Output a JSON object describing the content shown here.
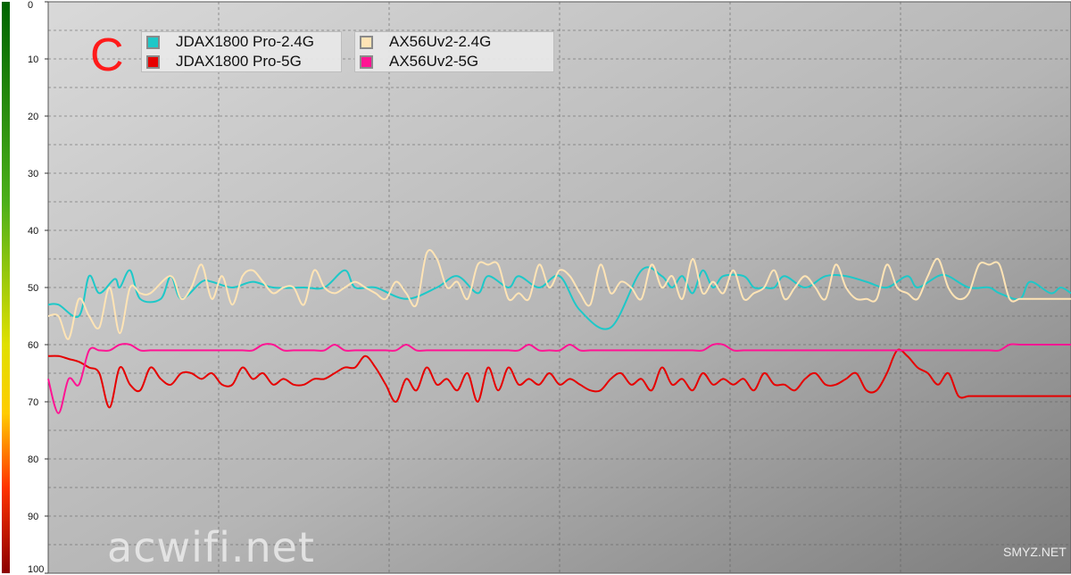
{
  "panel_letter": "C",
  "watermarks": {
    "main": "acwifi.net",
    "small": "SMYZ.NET"
  },
  "chart_data": {
    "type": "line",
    "title": "",
    "xlabel": "",
    "ylabel": "",
    "ylim": [
      100,
      0
    ],
    "yticks": [
      "0",
      "10",
      "20",
      "30",
      "40",
      "50",
      "60",
      "70",
      "80",
      "90",
      "100"
    ],
    "xlim": [
      0,
      100
    ],
    "grid": true,
    "legend_position": "top-left",
    "colors": {
      "background_top": "#d4d4d4",
      "background_bottom": "#808080"
    },
    "series": [
      {
        "name": "JDAX1800 Pro-2.4G",
        "color": "#1ec8c8",
        "x": [
          0,
          1,
          3,
          4,
          5,
          6.5,
          7,
          8,
          9,
          11,
          12,
          13,
          15,
          16,
          18,
          20,
          22,
          25,
          27,
          29,
          30,
          32,
          35,
          38,
          40,
          42,
          43,
          45,
          46,
          48,
          50,
          52,
          55,
          58,
          60,
          61,
          62,
          63,
          64,
          65,
          66,
          68,
          69,
          70,
          71,
          72,
          74,
          76,
          78,
          80,
          82,
          84,
          85,
          87,
          88,
          90,
          92,
          93,
          95,
          96,
          98,
          99,
          100
        ],
        "y": [
          53,
          53,
          55,
          48,
          51,
          48.5,
          50,
          47,
          52,
          52,
          48,
          52,
          49,
          49,
          50,
          49,
          50,
          50,
          50,
          47,
          50,
          50,
          52,
          50,
          48,
          51,
          48,
          50,
          48,
          50,
          48,
          54,
          57,
          47,
          48,
          50,
          48,
          51,
          47,
          50,
          48,
          48,
          50,
          50,
          50,
          48,
          50,
          48,
          48,
          49,
          50,
          48,
          50,
          48,
          48,
          50,
          50,
          51,
          52,
          49,
          51,
          50,
          51
        ],
        "note": ""
      },
      {
        "name": "AX56Uv2-2.4G",
        "color": "#ffe4b5",
        "x": [
          0,
          1,
          2,
          3,
          4,
          5,
          6,
          7,
          8,
          9,
          10,
          12,
          13,
          14,
          15,
          16,
          17,
          18,
          19,
          20,
          21,
          22,
          23,
          24,
          25,
          26,
          27,
          28,
          29,
          30,
          31,
          32,
          33,
          34,
          35,
          36,
          37,
          38,
          39,
          40,
          41,
          42,
          43,
          44,
          45,
          46,
          47,
          48,
          49,
          50,
          51,
          52,
          53,
          54,
          55,
          56,
          57,
          58,
          59,
          60,
          61,
          62,
          63,
          64,
          65,
          66,
          67,
          68,
          69,
          70,
          71,
          72,
          73,
          74,
          75,
          76,
          77,
          78,
          79,
          80,
          81,
          82,
          83,
          84,
          85,
          86,
          87,
          88,
          89,
          90,
          91,
          92,
          93,
          94,
          95,
          96,
          97,
          98,
          99,
          100
        ],
        "y": [
          55,
          55,
          59,
          52,
          55,
          57,
          50,
          58,
          50,
          51,
          51,
          48,
          52,
          50,
          46,
          52,
          48,
          53,
          48,
          47,
          49,
          51,
          50,
          50,
          53,
          47,
          50,
          51,
          50,
          49,
          50,
          51,
          52,
          49,
          51,
          53,
          44,
          45,
          50,
          49,
          52,
          46,
          46,
          46,
          52,
          51,
          52,
          46,
          50,
          47,
          48,
          51,
          53,
          46,
          51,
          49,
          50,
          52,
          46,
          50,
          48,
          52,
          45,
          51,
          49,
          51,
          47,
          52,
          51,
          50,
          47,
          52,
          50,
          48,
          50,
          52,
          46,
          50,
          52,
          52,
          52,
          46,
          50,
          51,
          52,
          48,
          45,
          50,
          52,
          51,
          46,
          46,
          46,
          52,
          52,
          52,
          52,
          52,
          52,
          52
        ],
        "note": ""
      },
      {
        "name": "JDAX1800 Pro-5G",
        "color": "#e60000",
        "x": [
          0,
          1,
          2,
          3,
          4,
          5,
          6,
          7,
          8,
          9,
          10,
          11,
          12,
          13,
          14,
          15,
          16,
          17,
          18,
          19,
          20,
          21,
          22,
          23,
          24,
          25,
          26,
          27,
          28,
          29,
          30,
          31,
          32,
          33,
          34,
          35,
          36,
          37,
          38,
          39,
          40,
          41,
          42,
          43,
          44,
          45,
          46,
          47,
          48,
          49,
          50,
          51,
          52,
          53,
          54,
          55,
          56,
          57,
          58,
          59,
          60,
          61,
          62,
          63,
          64,
          65,
          66,
          67,
          68,
          69,
          70,
          71,
          72,
          73,
          74,
          75,
          76,
          77,
          78,
          79,
          80,
          81,
          82,
          83,
          84,
          85,
          86,
          87,
          88,
          89,
          90,
          91,
          92,
          93,
          94,
          95,
          96,
          97,
          98,
          99,
          100
        ],
        "y": [
          62,
          62,
          62.5,
          63,
          64,
          65,
          71,
          64,
          67,
          68,
          64,
          66,
          67,
          65,
          65,
          66,
          65,
          67,
          67,
          64,
          66,
          65,
          67,
          66,
          67,
          67,
          66,
          66,
          65,
          64,
          64,
          62,
          64,
          67,
          70,
          66,
          68,
          64,
          67,
          66,
          68,
          65,
          70,
          64,
          68,
          64,
          67,
          66,
          67,
          65,
          67,
          66,
          67,
          68,
          68,
          66,
          65,
          67,
          66,
          68,
          64,
          67,
          66,
          68,
          65,
          67,
          66,
          67,
          66,
          68,
          65,
          67,
          67,
          68,
          66,
          65,
          67,
          67,
          66,
          65,
          68,
          68,
          65,
          61,
          62,
          64,
          65,
          67,
          65,
          69,
          69,
          69,
          69,
          69,
          69,
          69,
          69,
          69,
          69,
          69,
          69
        ],
        "note": ""
      },
      {
        "name": "AX56Uv2-5G",
        "color": "#ff1493",
        "x": [
          0,
          1,
          2,
          3,
          4,
          5,
          6,
          7,
          8,
          9,
          10,
          11,
          12,
          13,
          14,
          15,
          16,
          17,
          18,
          19,
          20,
          21,
          22,
          23,
          24,
          25,
          26,
          27,
          28,
          29,
          30,
          31,
          32,
          33,
          34,
          35,
          36,
          37,
          38,
          39,
          40,
          41,
          42,
          43,
          44,
          45,
          46,
          47,
          48,
          49,
          50,
          51,
          52,
          53,
          54,
          55,
          56,
          57,
          58,
          59,
          60,
          61,
          62,
          63,
          64,
          65,
          66,
          67,
          68,
          69,
          70,
          71,
          72,
          73,
          74,
          75,
          76,
          77,
          78,
          79,
          80,
          81,
          82,
          83,
          84,
          85,
          86,
          87,
          88,
          89,
          90,
          91,
          92,
          93,
          94,
          95,
          96,
          97,
          98,
          99,
          100
        ],
        "y": [
          66,
          72,
          66,
          67,
          61,
          61,
          61,
          60,
          60,
          61,
          61,
          61,
          61,
          61,
          61,
          61,
          61,
          61,
          61,
          61,
          61,
          60,
          60,
          61,
          61,
          61,
          61,
          61,
          60,
          61,
          61,
          61,
          61,
          61,
          61,
          60,
          61,
          61,
          61,
          61,
          61,
          61,
          61,
          61,
          61,
          61,
          61,
          60,
          61,
          61,
          61,
          60,
          61,
          61,
          61,
          61,
          61,
          61,
          61,
          61,
          61,
          61,
          61,
          61,
          61,
          60,
          60,
          61,
          61,
          61,
          61,
          61,
          61,
          61,
          61,
          61,
          61,
          61,
          61,
          61,
          61,
          61,
          61,
          61,
          61,
          61,
          61,
          61,
          61,
          61,
          61,
          61,
          61,
          61,
          60,
          60,
          60,
          60,
          60,
          60,
          60
        ],
        "note": ""
      }
    ]
  },
  "legend": [
    {
      "label": "JDAX1800 Pro-2.4G",
      "color": "#1ec8c8"
    },
    {
      "label": "JDAX1800 Pro-5G",
      "color": "#e60000"
    },
    {
      "label": "AX56Uv2-2.4G",
      "color": "#ffe4b5"
    },
    {
      "label": "AX56Uv2-5G",
      "color": "#ff1493"
    }
  ]
}
